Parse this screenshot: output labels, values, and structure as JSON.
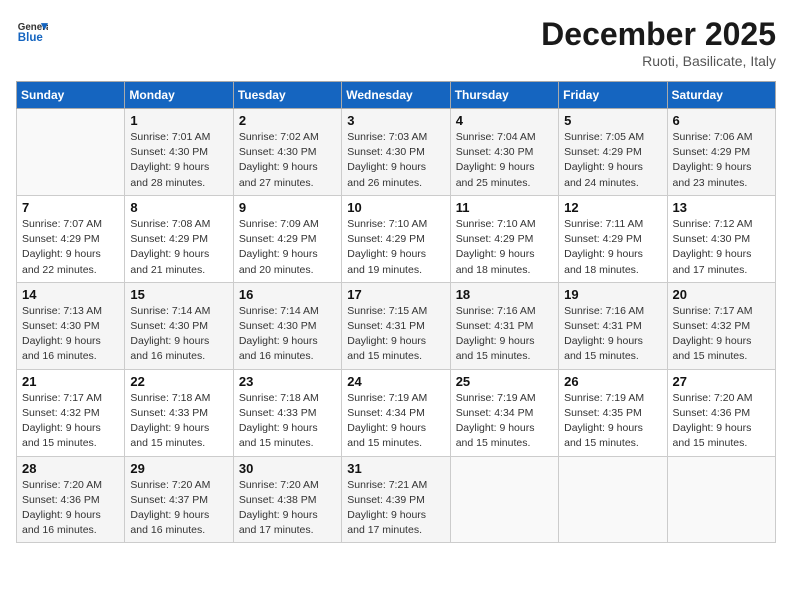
{
  "header": {
    "logo_general": "General",
    "logo_blue": "Blue",
    "month_title": "December 2025",
    "location": "Ruoti, Basilicate, Italy"
  },
  "days_of_week": [
    "Sunday",
    "Monday",
    "Tuesday",
    "Wednesday",
    "Thursday",
    "Friday",
    "Saturday"
  ],
  "weeks": [
    [
      {
        "day": "",
        "sunrise": "",
        "sunset": "",
        "daylight": ""
      },
      {
        "day": "1",
        "sunrise": "Sunrise: 7:01 AM",
        "sunset": "Sunset: 4:30 PM",
        "daylight": "Daylight: 9 hours and 28 minutes."
      },
      {
        "day": "2",
        "sunrise": "Sunrise: 7:02 AM",
        "sunset": "Sunset: 4:30 PM",
        "daylight": "Daylight: 9 hours and 27 minutes."
      },
      {
        "day": "3",
        "sunrise": "Sunrise: 7:03 AM",
        "sunset": "Sunset: 4:30 PM",
        "daylight": "Daylight: 9 hours and 26 minutes."
      },
      {
        "day": "4",
        "sunrise": "Sunrise: 7:04 AM",
        "sunset": "Sunset: 4:30 PM",
        "daylight": "Daylight: 9 hours and 25 minutes."
      },
      {
        "day": "5",
        "sunrise": "Sunrise: 7:05 AM",
        "sunset": "Sunset: 4:29 PM",
        "daylight": "Daylight: 9 hours and 24 minutes."
      },
      {
        "day": "6",
        "sunrise": "Sunrise: 7:06 AM",
        "sunset": "Sunset: 4:29 PM",
        "daylight": "Daylight: 9 hours and 23 minutes."
      }
    ],
    [
      {
        "day": "7",
        "sunrise": "Sunrise: 7:07 AM",
        "sunset": "Sunset: 4:29 PM",
        "daylight": "Daylight: 9 hours and 22 minutes."
      },
      {
        "day": "8",
        "sunrise": "Sunrise: 7:08 AM",
        "sunset": "Sunset: 4:29 PM",
        "daylight": "Daylight: 9 hours and 21 minutes."
      },
      {
        "day": "9",
        "sunrise": "Sunrise: 7:09 AM",
        "sunset": "Sunset: 4:29 PM",
        "daylight": "Daylight: 9 hours and 20 minutes."
      },
      {
        "day": "10",
        "sunrise": "Sunrise: 7:10 AM",
        "sunset": "Sunset: 4:29 PM",
        "daylight": "Daylight: 9 hours and 19 minutes."
      },
      {
        "day": "11",
        "sunrise": "Sunrise: 7:10 AM",
        "sunset": "Sunset: 4:29 PM",
        "daylight": "Daylight: 9 hours and 18 minutes."
      },
      {
        "day": "12",
        "sunrise": "Sunrise: 7:11 AM",
        "sunset": "Sunset: 4:29 PM",
        "daylight": "Daylight: 9 hours and 18 minutes."
      },
      {
        "day": "13",
        "sunrise": "Sunrise: 7:12 AM",
        "sunset": "Sunset: 4:30 PM",
        "daylight": "Daylight: 9 hours and 17 minutes."
      }
    ],
    [
      {
        "day": "14",
        "sunrise": "Sunrise: 7:13 AM",
        "sunset": "Sunset: 4:30 PM",
        "daylight": "Daylight: 9 hours and 16 minutes."
      },
      {
        "day": "15",
        "sunrise": "Sunrise: 7:14 AM",
        "sunset": "Sunset: 4:30 PM",
        "daylight": "Daylight: 9 hours and 16 minutes."
      },
      {
        "day": "16",
        "sunrise": "Sunrise: 7:14 AM",
        "sunset": "Sunset: 4:30 PM",
        "daylight": "Daylight: 9 hours and 16 minutes."
      },
      {
        "day": "17",
        "sunrise": "Sunrise: 7:15 AM",
        "sunset": "Sunset: 4:31 PM",
        "daylight": "Daylight: 9 hours and 15 minutes."
      },
      {
        "day": "18",
        "sunrise": "Sunrise: 7:16 AM",
        "sunset": "Sunset: 4:31 PM",
        "daylight": "Daylight: 9 hours and 15 minutes."
      },
      {
        "day": "19",
        "sunrise": "Sunrise: 7:16 AM",
        "sunset": "Sunset: 4:31 PM",
        "daylight": "Daylight: 9 hours and 15 minutes."
      },
      {
        "day": "20",
        "sunrise": "Sunrise: 7:17 AM",
        "sunset": "Sunset: 4:32 PM",
        "daylight": "Daylight: 9 hours and 15 minutes."
      }
    ],
    [
      {
        "day": "21",
        "sunrise": "Sunrise: 7:17 AM",
        "sunset": "Sunset: 4:32 PM",
        "daylight": "Daylight: 9 hours and 15 minutes."
      },
      {
        "day": "22",
        "sunrise": "Sunrise: 7:18 AM",
        "sunset": "Sunset: 4:33 PM",
        "daylight": "Daylight: 9 hours and 15 minutes."
      },
      {
        "day": "23",
        "sunrise": "Sunrise: 7:18 AM",
        "sunset": "Sunset: 4:33 PM",
        "daylight": "Daylight: 9 hours and 15 minutes."
      },
      {
        "day": "24",
        "sunrise": "Sunrise: 7:19 AM",
        "sunset": "Sunset: 4:34 PM",
        "daylight": "Daylight: 9 hours and 15 minutes."
      },
      {
        "day": "25",
        "sunrise": "Sunrise: 7:19 AM",
        "sunset": "Sunset: 4:34 PM",
        "daylight": "Daylight: 9 hours and 15 minutes."
      },
      {
        "day": "26",
        "sunrise": "Sunrise: 7:19 AM",
        "sunset": "Sunset: 4:35 PM",
        "daylight": "Daylight: 9 hours and 15 minutes."
      },
      {
        "day": "27",
        "sunrise": "Sunrise: 7:20 AM",
        "sunset": "Sunset: 4:36 PM",
        "daylight": "Daylight: 9 hours and 15 minutes."
      }
    ],
    [
      {
        "day": "28",
        "sunrise": "Sunrise: 7:20 AM",
        "sunset": "Sunset: 4:36 PM",
        "daylight": "Daylight: 9 hours and 16 minutes."
      },
      {
        "day": "29",
        "sunrise": "Sunrise: 7:20 AM",
        "sunset": "Sunset: 4:37 PM",
        "daylight": "Daylight: 9 hours and 16 minutes."
      },
      {
        "day": "30",
        "sunrise": "Sunrise: 7:20 AM",
        "sunset": "Sunset: 4:38 PM",
        "daylight": "Daylight: 9 hours and 17 minutes."
      },
      {
        "day": "31",
        "sunrise": "Sunrise: 7:21 AM",
        "sunset": "Sunset: 4:39 PM",
        "daylight": "Daylight: 9 hours and 17 minutes."
      },
      {
        "day": "",
        "sunrise": "",
        "sunset": "",
        "daylight": ""
      },
      {
        "day": "",
        "sunrise": "",
        "sunset": "",
        "daylight": ""
      },
      {
        "day": "",
        "sunrise": "",
        "sunset": "",
        "daylight": ""
      }
    ]
  ]
}
